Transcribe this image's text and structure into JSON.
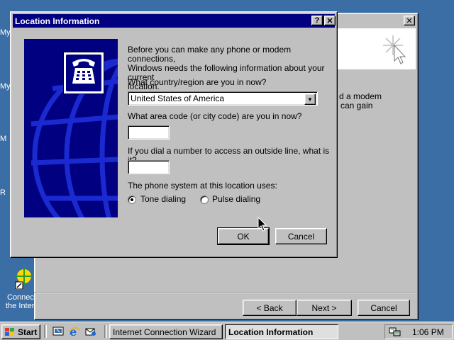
{
  "desktop": {
    "icons": [
      {
        "label": "My"
      },
      {
        "label": "My"
      },
      {
        "label": "M"
      },
      {
        "label": "R"
      }
    ],
    "connect_icon_label_1": "Connect",
    "connect_icon_label_2": "the Inter"
  },
  "wizard": {
    "close_glyph": "✕",
    "text_line_1": "d a modem",
    "text_line_2": "can gain",
    "back_label": "< Back",
    "next_label": "Next >",
    "cancel_label": "Cancel"
  },
  "dialog": {
    "title": "Location Information",
    "help_glyph": "?",
    "close_glyph": "✕",
    "intro": "Before you can make any phone or modem connections,\nWindows needs the following information about your current\nlocation.",
    "country_label": "What country/region are you in now?",
    "country_value": "United States of America",
    "area_code_label": "What area code (or city code) are you in now?",
    "area_code_value": "",
    "outside_line_label": "If you dial a number to access an outside line, what is it?",
    "outside_line_value": "",
    "phone_system_label": "The phone system at this location uses:",
    "tone_label": "Tone dialing",
    "pulse_label": "Pulse dialing",
    "dialing_selected": "tone",
    "ok_label": "OK",
    "cancel_label": "Cancel"
  },
  "taskbar": {
    "start_label": "Start",
    "tasks": [
      {
        "label": "Internet Connection Wizard"
      },
      {
        "label": "Location Information"
      }
    ],
    "clock": "1:06 PM"
  },
  "colors": {
    "desktop": "#3a6ea5",
    "titlebar": "#000080",
    "face": "#c0c0c0"
  }
}
